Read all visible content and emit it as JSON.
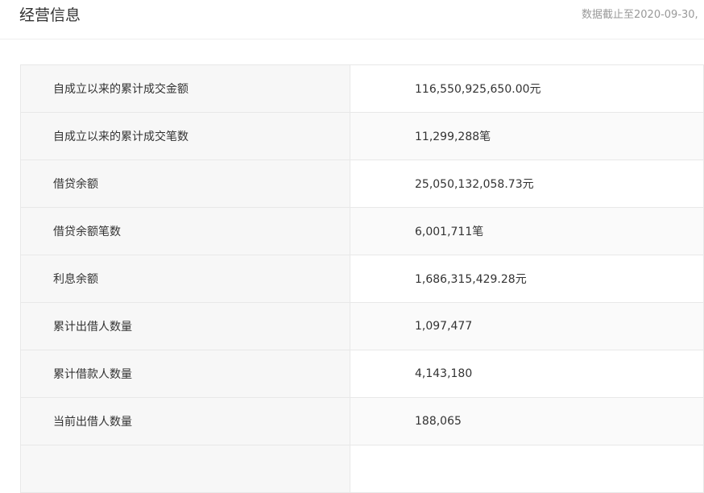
{
  "header": {
    "title": "经营信息",
    "data_date": "数据截止至2020-09-30,"
  },
  "rows": [
    {
      "label": "自成立以来的累计成交金额",
      "value": "116,550,925,650.00元"
    },
    {
      "label": "自成立以来的累计成交笔数",
      "value": "11,299,288笔"
    },
    {
      "label": "借贷余额",
      "value": "25,050,132,058.73元"
    },
    {
      "label": "借贷余额笔数",
      "value": "6,001,711笔"
    },
    {
      "label": "利息余额",
      "value": "1,686,315,429.28元"
    },
    {
      "label": "累计出借人数量",
      "value": "1,097,477"
    },
    {
      "label": "累计借款人数量",
      "value": "4,143,180"
    },
    {
      "label": "当前出借人数量",
      "value": "188,065"
    },
    {
      "label": "",
      "value": ""
    }
  ]
}
